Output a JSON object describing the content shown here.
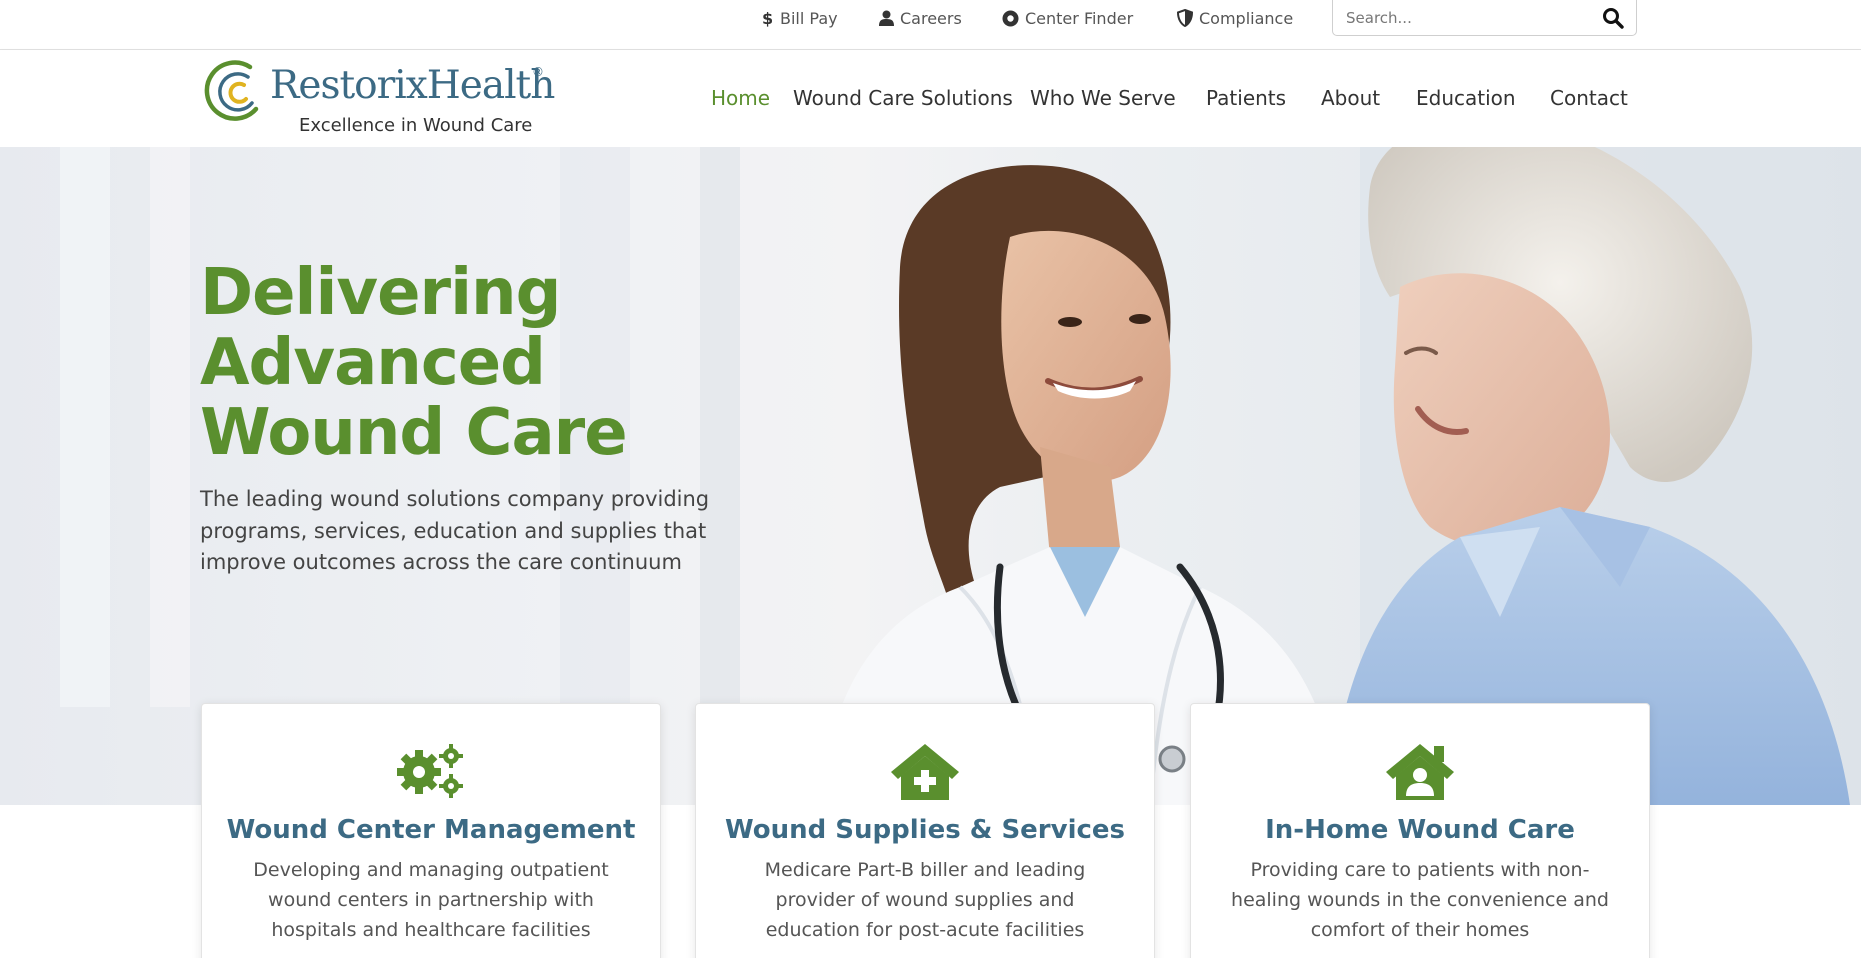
{
  "utility": {
    "links": [
      {
        "label": "Bill Pay",
        "icon": "dollar-icon"
      },
      {
        "label": "Careers",
        "icon": "user-icon"
      },
      {
        "label": "Center Finder",
        "icon": "map-pin-icon"
      },
      {
        "label": "Compliance",
        "icon": "shield-icon"
      }
    ],
    "search_placeholder": "Search...",
    "search_icon": "search-icon"
  },
  "header": {
    "logo_text": "RestorixHealth",
    "logo_reg": "®",
    "logo_tagline": "Excellence in Wound Care",
    "nav": [
      {
        "label": "Home",
        "active": true
      },
      {
        "label": "Wound Care Solutions",
        "active": false
      },
      {
        "label": "Who We Serve",
        "active": false
      },
      {
        "label": "Patients",
        "active": false
      },
      {
        "label": "About",
        "active": false
      },
      {
        "label": "Education",
        "active": false
      },
      {
        "label": "Contact",
        "active": false
      }
    ]
  },
  "hero": {
    "title_lines": [
      "Delivering",
      "Advanced",
      "Wound Care"
    ],
    "subtitle": "The leading wound solutions company providing programs, services, education and supplies that improve outcomes across the care continuum"
  },
  "cards": [
    {
      "icon": "gears-icon",
      "title": "Wound Center Management",
      "text": "Developing and managing outpatient wound centers in partnership with hospitals and healthcare facilities"
    },
    {
      "icon": "house-medical-icon",
      "title": "Wound Supplies & Services",
      "text": "Medicare Part-B biller and leading provider of wound supplies and education for post-acute facilities"
    },
    {
      "icon": "house-user-icon",
      "title": "In-Home Wound Care",
      "text": "Providing care to patients with non-healing wounds in the convenience and comfort of their homes"
    }
  ],
  "colors": {
    "brand_green": "#5a8f2e",
    "brand_blue": "#3c6a84",
    "logo_gold": "#e0b320",
    "text_dark": "#333333"
  }
}
